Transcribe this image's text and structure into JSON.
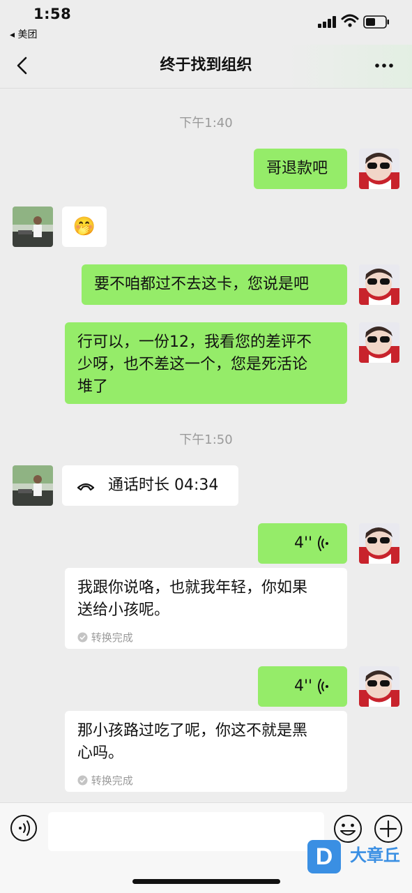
{
  "status_bar": {
    "time": "1:58",
    "back_app": "◂ 美团"
  },
  "nav": {
    "title": "终于找到组织"
  },
  "timestamps": [
    "下午1:40",
    "下午1:50"
  ],
  "messages": {
    "m1": "哥退款吧",
    "m2_emoji": "🤭",
    "m3": "要不咱都过不去这卡，您说是吧",
    "m4": "行可以，一份12，我看您的差评不\n少呀，也不差这一个，您是死活论\n堆了",
    "m5_call": "通话时长 04:34",
    "m6_voice": "4''",
    "m6_text": "我跟你说咯，也就我年轻，你如果\n送给小孩呢。",
    "m6_status": "转换完成",
    "m7_voice": "4''",
    "m7_text": "那小孩路过吃了呢，你这不就是黑\n心吗。",
    "m7_status": "转换完成"
  },
  "input": {
    "placeholder": ""
  },
  "watermark": {
    "logo": "D",
    "text": "大章丘"
  },
  "colors": {
    "bubble_mine": "#95ec69",
    "bubble_other": "#ffffff",
    "background": "#ededed"
  }
}
